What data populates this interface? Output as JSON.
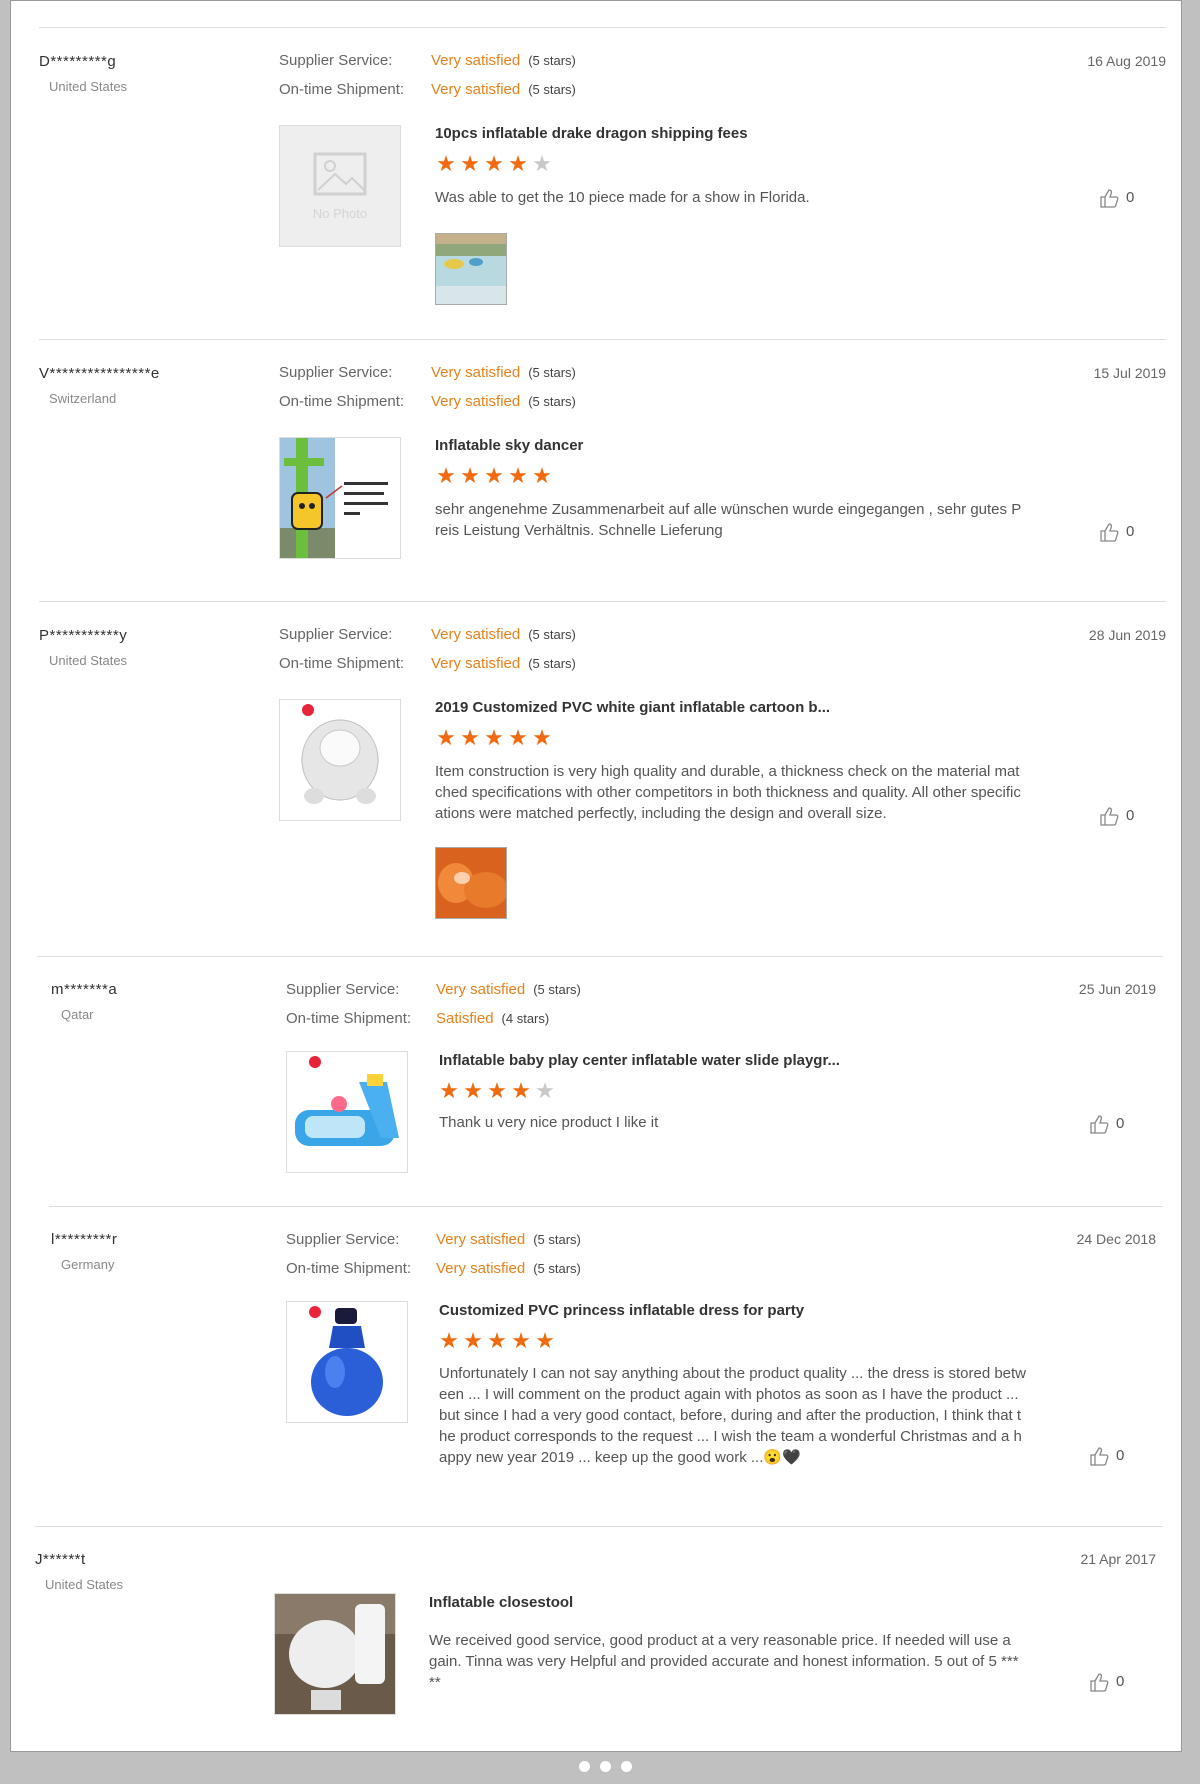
{
  "labels": {
    "supplier_service": "Supplier Service:",
    "on_time_shipment": "On-time Shipment:"
  },
  "reviews": [
    {
      "buyer": "D*********g",
      "country": "United States",
      "supplier_value": "Very satisfied",
      "supplier_stars": "(5 stars)",
      "shipment_value": "Very satisfied",
      "shipment_stars": "(5 stars)",
      "date": "16 Aug 2019",
      "product_title": "10pcs inflatable drake dragon shipping fees",
      "rating": 4,
      "comment": "Was able to get the 10 piece made for a show in Florida.",
      "likes": "0",
      "no_photo_text": "No Photo"
    },
    {
      "buyer": "V****************e",
      "country": "Switzerland",
      "supplier_value": "Very satisfied",
      "supplier_stars": "(5 stars)",
      "shipment_value": "Very satisfied",
      "shipment_stars": "(5 stars)",
      "date": "15 Jul 2019",
      "product_title": "Inflatable sky dancer",
      "rating": 5,
      "comment": "sehr angenehme Zusammenarbeit auf alle wünschen wurde eingegangen , sehr gutes Preis Leistung Verhältnis. Schnelle Lieferung",
      "likes": "0"
    },
    {
      "buyer": "P***********y",
      "country": "United States",
      "supplier_value": "Very satisfied",
      "supplier_stars": "(5 stars)",
      "shipment_value": "Very satisfied",
      "shipment_stars": "(5 stars)",
      "date": "28 Jun 2019",
      "product_title": "2019 Customized PVC white giant inflatable cartoon b...",
      "rating": 5,
      "comment": "Item construction is very high quality and durable, a thickness check on the material matched specifications with other competitors in both thickness and quality. All other specifications were matched perfectly, including the design and overall size.",
      "likes": "0"
    },
    {
      "buyer": "m*******a",
      "country": "Qatar",
      "supplier_value": "Very satisfied",
      "supplier_stars": "(5 stars)",
      "shipment_value": "Satisfied",
      "shipment_stars": "(4 stars)",
      "date": "25 Jun 2019",
      "product_title": "Inflatable baby play center inflatable water slide playgr...",
      "rating": 4,
      "comment": "Thank u very nice product I like it",
      "likes": "0"
    },
    {
      "buyer": "l*********r",
      "country": "Germany",
      "supplier_value": "Very satisfied",
      "supplier_stars": "(5 stars)",
      "shipment_value": "Very satisfied",
      "shipment_stars": "(5 stars)",
      "date": "24 Dec 2018",
      "product_title": "Customized PVC princess inflatable dress for party",
      "rating": 5,
      "comment": "Unfortunately I can not say anything about the product quality ... the dress is stored between ... I will comment on the product again with photos as soon as I have the product ... but since I had a very good contact, before, during and after the production, I think that the product corresponds to the request ... I wish the team a wonderful Christmas and a happy new year 2019 ... keep up the good work ...😮🖤",
      "likes": "0"
    },
    {
      "buyer": "J******t",
      "country": "United States",
      "date": "21 Apr 2017",
      "product_title": "Inflatable closestool",
      "comment": "We received good service, good product at a very reasonable price. If needed will use again. Tinna was very Helpful and provided accurate and honest information. 5 out of 5 *****",
      "likes": "0"
    }
  ],
  "colors": {
    "accent": "#e8811a",
    "star_on": "#f06a0f",
    "star_off": "#c8c8c8"
  },
  "icons": {
    "like": "thumbs-up-icon"
  }
}
